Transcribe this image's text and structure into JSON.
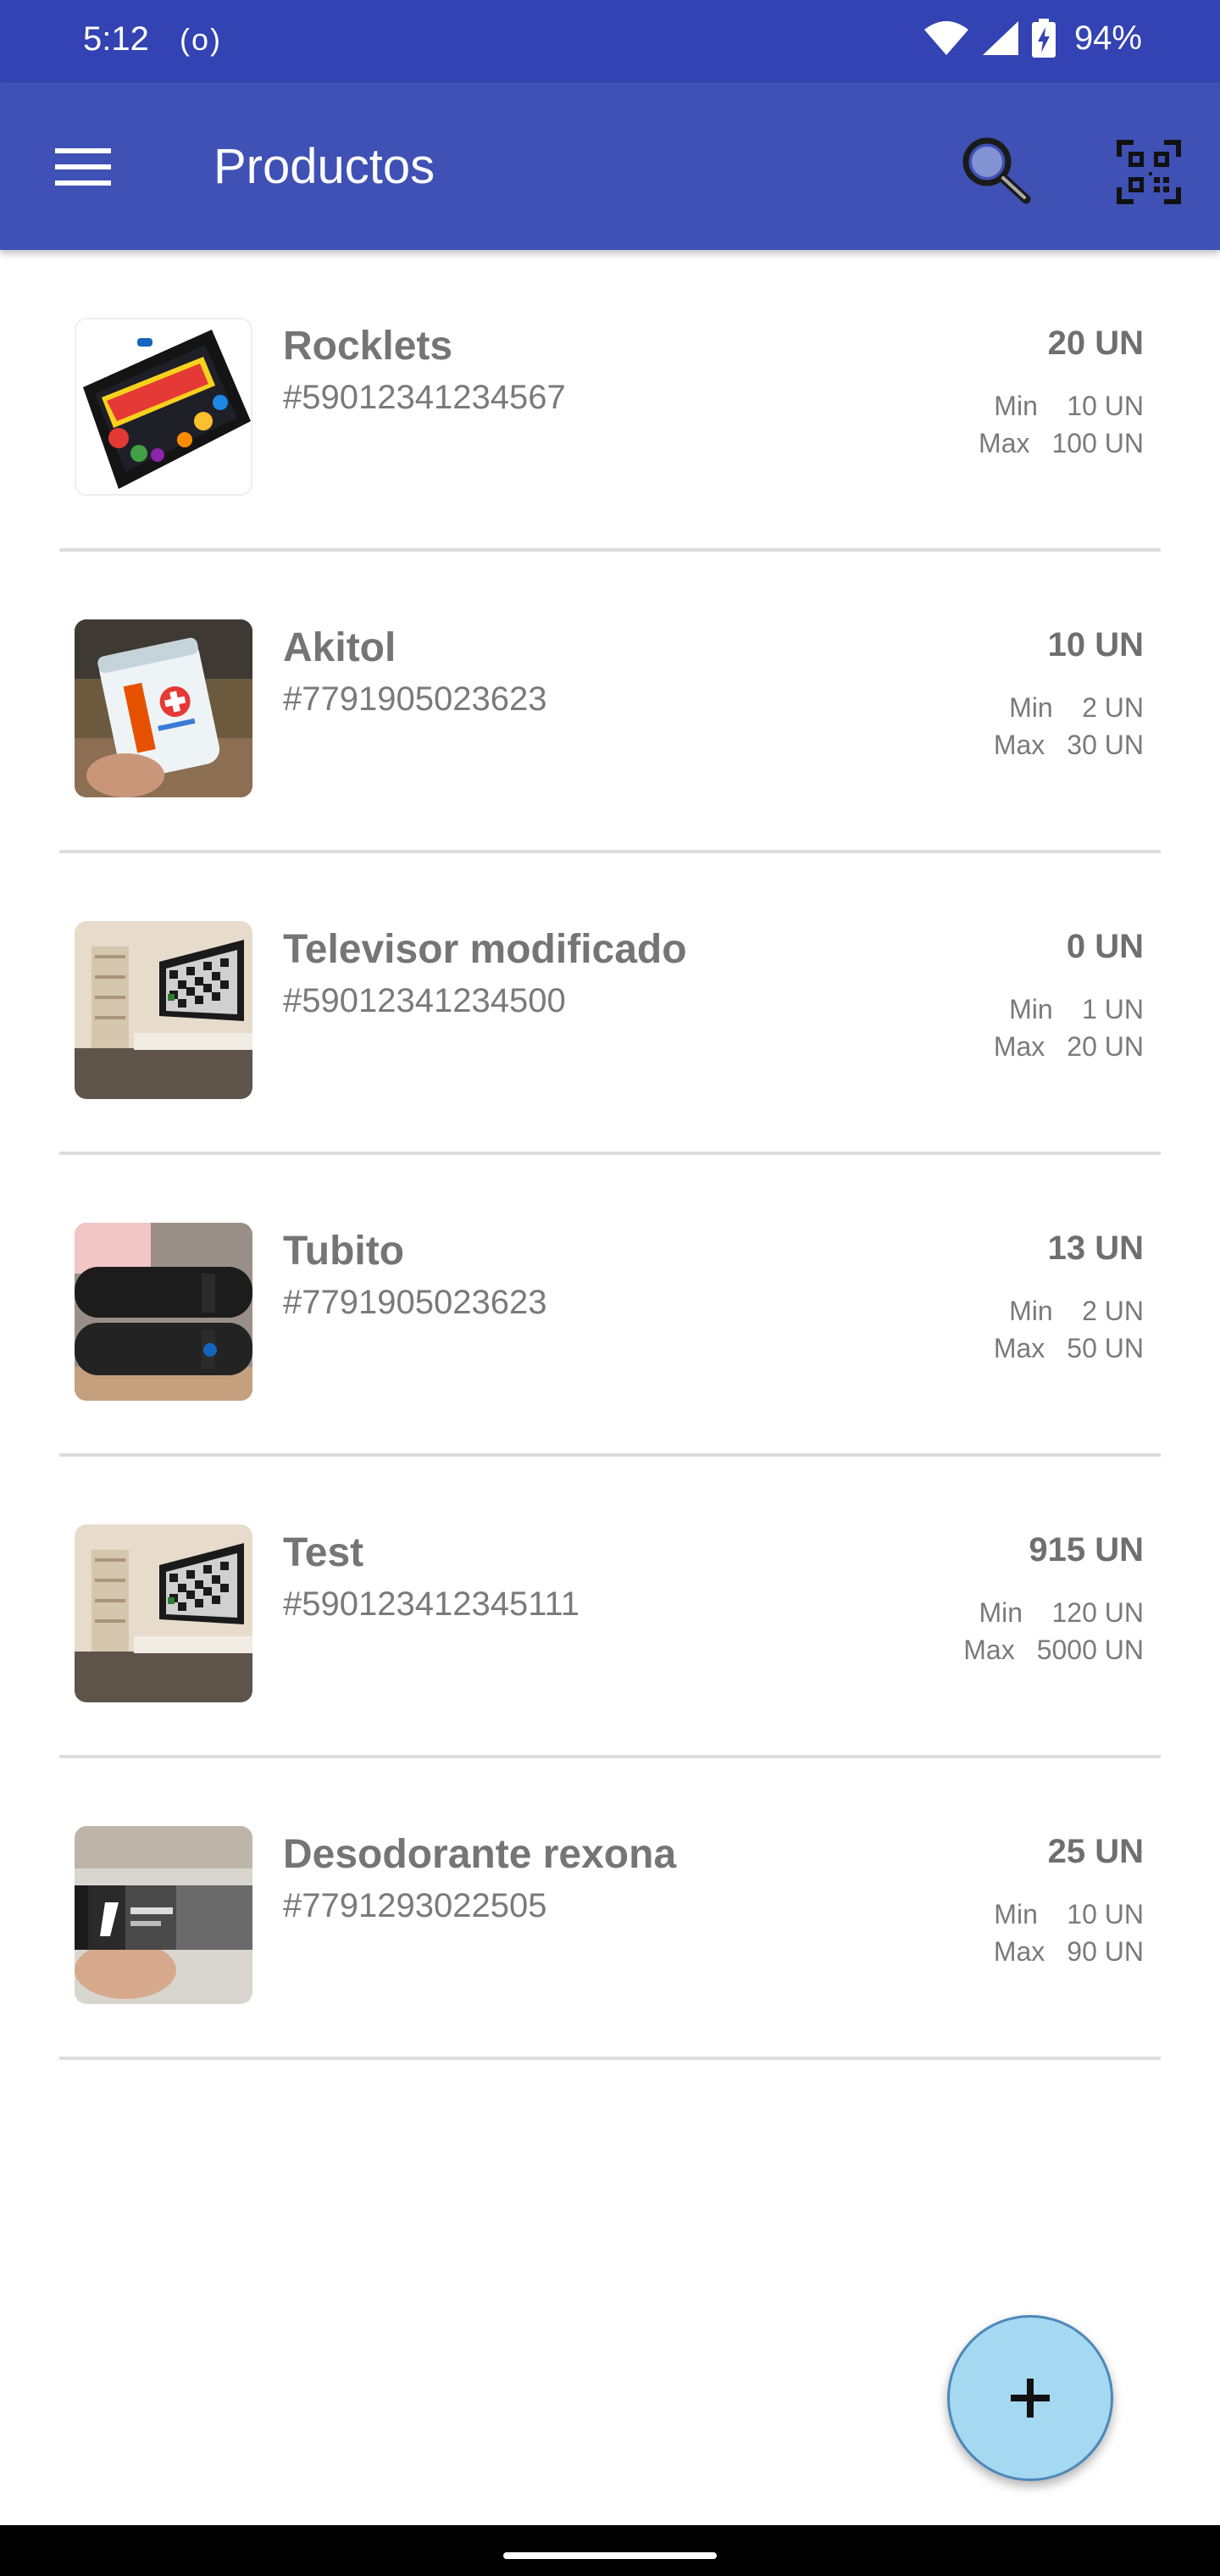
{
  "status_bar": {
    "time": "5:12",
    "radio_indicator": "(o)",
    "battery_percent": "94%",
    "icons": [
      "wifi-icon",
      "cell-signal-icon",
      "battery-charging-icon"
    ]
  },
  "app_bar": {
    "title": "Productos",
    "background_color": "#3f51b5",
    "icons": [
      "menu-icon",
      "search-icon",
      "qr-scan-icon"
    ]
  },
  "products": [
    {
      "name": "Rocklets",
      "code": "#59012341234567",
      "stock": "20 UN",
      "min_label": "Min",
      "min": "10 UN",
      "max_label": "Max",
      "max": "100 UN"
    },
    {
      "name": "Akitol",
      "code": "#7791905023623",
      "stock": "10 UN",
      "min_label": "Min",
      "min": "2 UN",
      "max_label": "Max",
      "max": "30 UN"
    },
    {
      "name": "Televisor modificado",
      "code": "#59012341234500",
      "stock": "0 UN",
      "min_label": "Min",
      "min": "1 UN",
      "max_label": "Max",
      "max": "20 UN"
    },
    {
      "name": "Tubito",
      "code": "#7791905023623",
      "stock": "13 UN",
      "min_label": "Min",
      "min": "2 UN",
      "max_label": "Max",
      "max": "50 UN"
    },
    {
      "name": "Test",
      "code": "#590123412345111",
      "stock": "915 UN",
      "min_label": "Min",
      "min": "120 UN",
      "max_label": "Max",
      "max": "5000 UN"
    },
    {
      "name": "Desodorante rexona",
      "code": "#7791293022505",
      "stock": "25 UN",
      "min_label": "Min",
      "min": "10 UN",
      "max_label": "Max",
      "max": "90 UN"
    }
  ],
  "fab": {
    "icon": "plus-icon",
    "color": "#a5d8f1"
  }
}
